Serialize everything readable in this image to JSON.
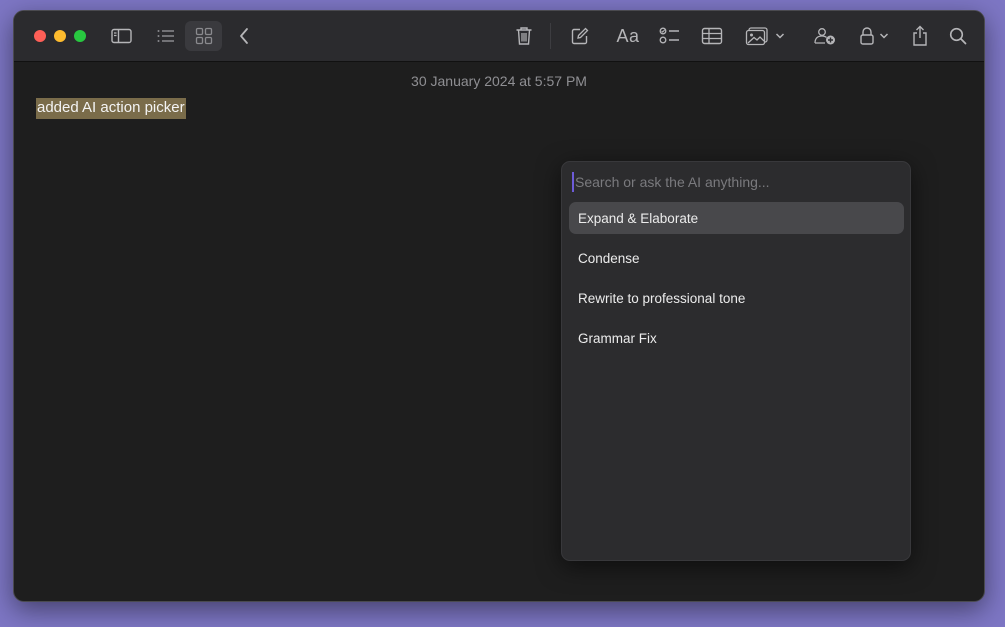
{
  "toolbar": {
    "buttons": [
      {
        "id": "sidebar",
        "icon": "sidebar-icon"
      },
      {
        "id": "list-view",
        "icon": "list-icon"
      },
      {
        "id": "gallery-view",
        "icon": "grid-icon"
      },
      {
        "id": "back",
        "icon": "chevron-left-icon"
      },
      {
        "id": "delete",
        "icon": "trash-icon"
      },
      {
        "id": "compose",
        "icon": "compose-icon"
      },
      {
        "id": "format",
        "icon": "text-format-icon",
        "label": "Aa"
      },
      {
        "id": "checklist",
        "icon": "checklist-icon"
      },
      {
        "id": "table",
        "icon": "table-icon"
      },
      {
        "id": "media",
        "icon": "photo-icon"
      },
      {
        "id": "collaborate",
        "icon": "collaborate-icon"
      },
      {
        "id": "lock",
        "icon": "lock-icon"
      },
      {
        "id": "share",
        "icon": "share-icon"
      },
      {
        "id": "search",
        "icon": "search-icon"
      }
    ]
  },
  "note": {
    "date": "30 January 2024 at 5:57 PM",
    "text": "added AI action picker"
  },
  "picker": {
    "placeholder": "Search or ask the AI anything...",
    "items": [
      {
        "label": "Expand & Elaborate",
        "selected": true
      },
      {
        "label": "Condense",
        "selected": false
      },
      {
        "label": "Rewrite to professional tone",
        "selected": false
      },
      {
        "label": "Grammar Fix",
        "selected": false
      }
    ]
  },
  "colors": {
    "desktop": "#7d76c4",
    "window_bg": "#1e1e1e",
    "toolbar_bg": "#2b2b2e",
    "highlight": "#7a6c4a",
    "picker_bg": "#2c2c2e",
    "selected_row": "#48484b",
    "caret": "#6d5bd8"
  }
}
